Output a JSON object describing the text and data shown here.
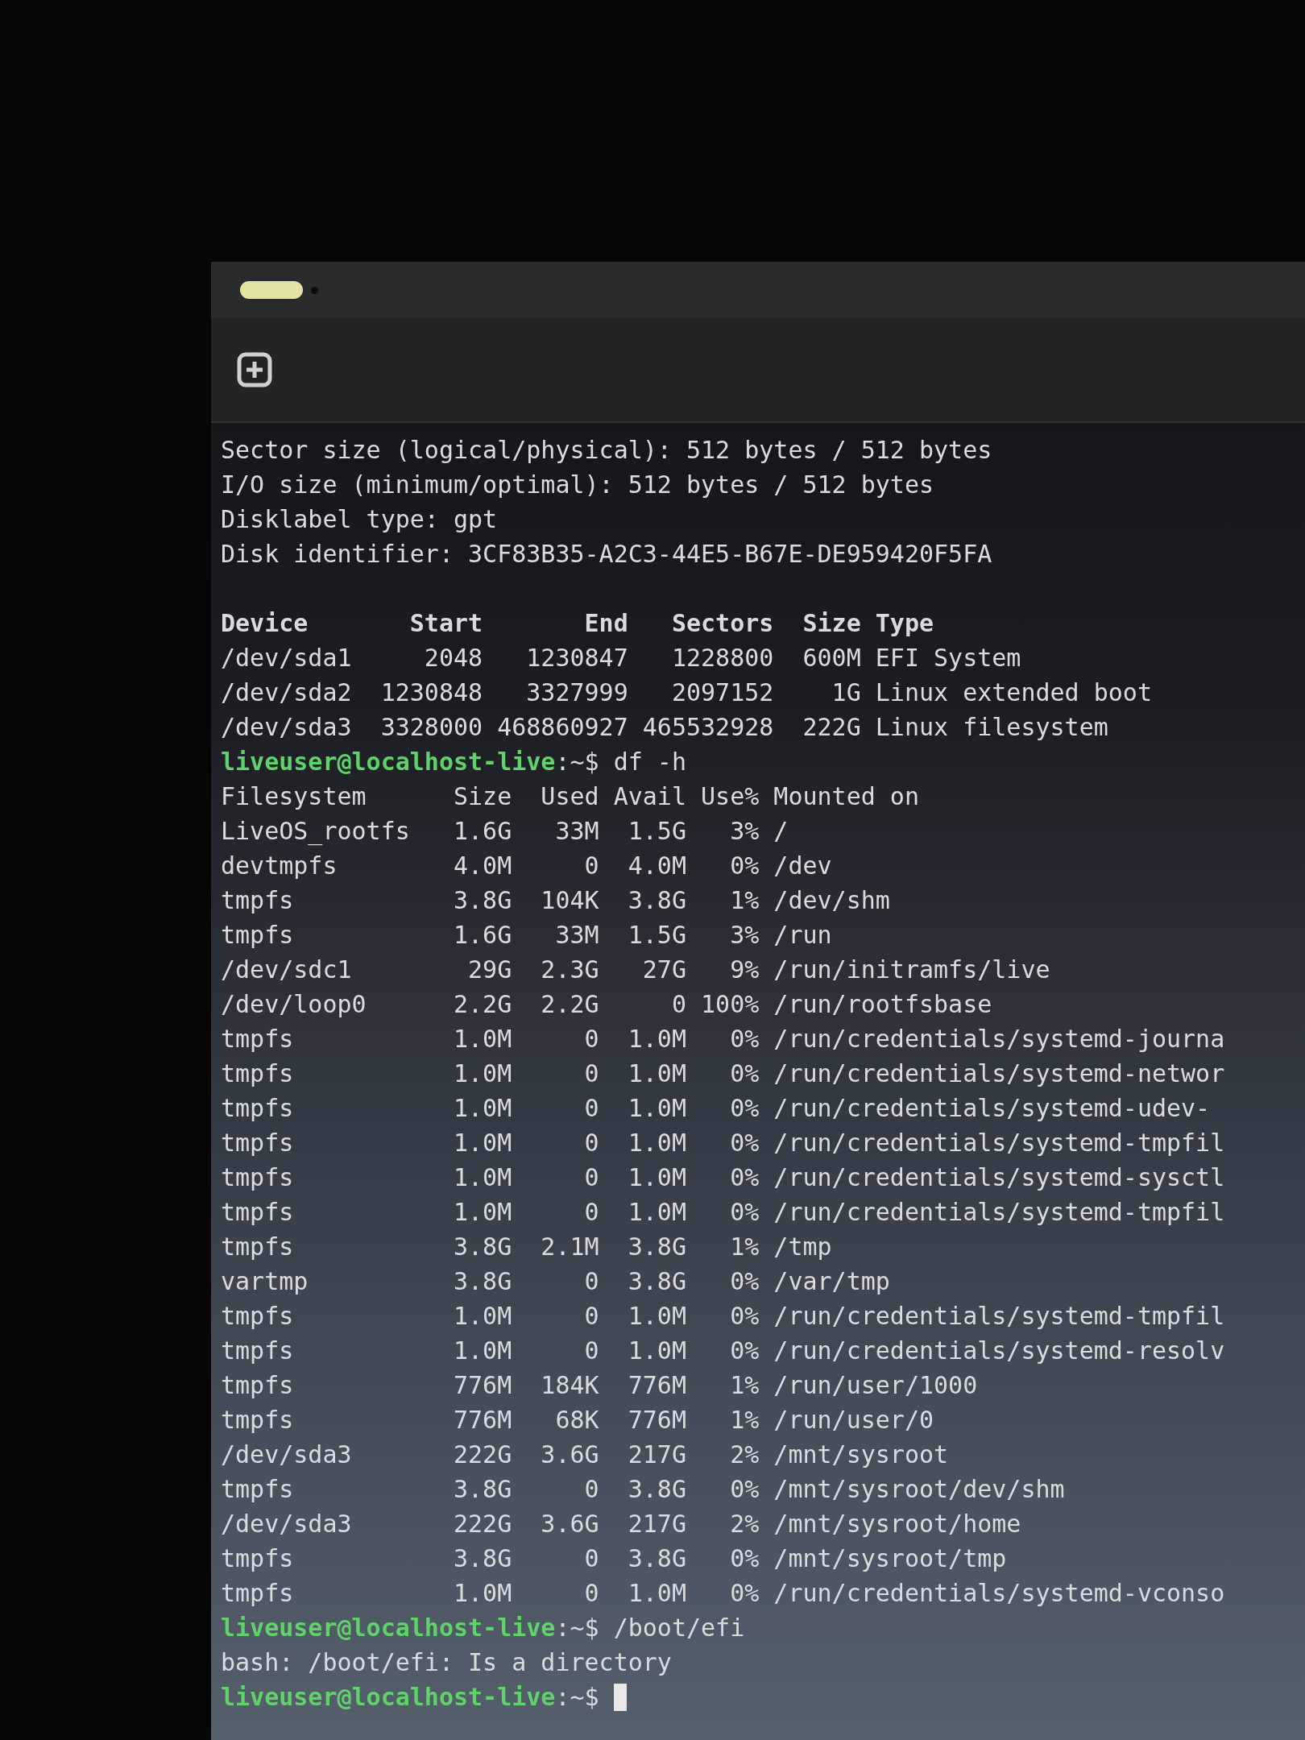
{
  "lines": [
    {
      "kind": "output",
      "text": "Sector size (logical/physical): 512 bytes / 512 bytes"
    },
    {
      "kind": "output",
      "text": "I/O size (minimum/optimal): 512 bytes / 512 bytes"
    },
    {
      "kind": "output",
      "text": "Disklabel type: gpt"
    },
    {
      "kind": "output",
      "text": "Disk identifier: 3CF83B35-A2C3-44E5-B67E-DE959420F5FA"
    },
    {
      "kind": "blank"
    },
    {
      "kind": "header",
      "text": "Device       Start       End   Sectors  Size Type"
    },
    {
      "kind": "output",
      "text": "/dev/sda1     2048   1230847   1228800  600M EFI System"
    },
    {
      "kind": "output",
      "text": "/dev/sda2  1230848   3327999   2097152    1G Linux extended boot"
    },
    {
      "kind": "output",
      "text": "/dev/sda3  3328000 468860927 465532928  222G Linux filesystem"
    },
    {
      "kind": "prompt",
      "prompt": "liveuser@localhost-live",
      "cwd": ":~$",
      "command": "df -h"
    },
    {
      "kind": "output",
      "text": "Filesystem      Size  Used Avail Use% Mounted on"
    },
    {
      "kind": "output",
      "text": "LiveOS_rootfs   1.6G   33M  1.5G   3% /"
    },
    {
      "kind": "output",
      "text": "devtmpfs        4.0M     0  4.0M   0% /dev"
    },
    {
      "kind": "output",
      "text": "tmpfs           3.8G  104K  3.8G   1% /dev/shm"
    },
    {
      "kind": "output",
      "text": "tmpfs           1.6G   33M  1.5G   3% /run"
    },
    {
      "kind": "output",
      "text": "/dev/sdc1        29G  2.3G   27G   9% /run/initramfs/live"
    },
    {
      "kind": "output",
      "text": "/dev/loop0      2.2G  2.2G     0 100% /run/rootfsbase"
    },
    {
      "kind": "output",
      "text": "tmpfs           1.0M     0  1.0M   0% /run/credentials/systemd-journa"
    },
    {
      "kind": "output",
      "text": "tmpfs           1.0M     0  1.0M   0% /run/credentials/systemd-networ"
    },
    {
      "kind": "output",
      "text": "tmpfs           1.0M     0  1.0M   0% /run/credentials/systemd-udev-"
    },
    {
      "kind": "output",
      "text": "tmpfs           1.0M     0  1.0M   0% /run/credentials/systemd-tmpfil"
    },
    {
      "kind": "output",
      "text": "tmpfs           1.0M     0  1.0M   0% /run/credentials/systemd-sysctl"
    },
    {
      "kind": "output",
      "text": "tmpfs           1.0M     0  1.0M   0% /run/credentials/systemd-tmpfil"
    },
    {
      "kind": "output",
      "text": "tmpfs           3.8G  2.1M  3.8G   1% /tmp"
    },
    {
      "kind": "output",
      "text": "vartmp          3.8G     0  3.8G   0% /var/tmp"
    },
    {
      "kind": "output",
      "text": "tmpfs           1.0M     0  1.0M   0% /run/credentials/systemd-tmpfil"
    },
    {
      "kind": "output",
      "text": "tmpfs           1.0M     0  1.0M   0% /run/credentials/systemd-resolv"
    },
    {
      "kind": "output",
      "text": "tmpfs           776M  184K  776M   1% /run/user/1000"
    },
    {
      "kind": "output",
      "text": "tmpfs           776M   68K  776M   1% /run/user/0"
    },
    {
      "kind": "output",
      "text": "/dev/sda3       222G  3.6G  217G   2% /mnt/sysroot"
    },
    {
      "kind": "output",
      "text": "tmpfs           3.8G     0  3.8G   0% /mnt/sysroot/dev/shm"
    },
    {
      "kind": "output",
      "text": "/dev/sda3       222G  3.6G  217G   2% /mnt/sysroot/home"
    },
    {
      "kind": "output",
      "text": "tmpfs           3.8G     0  3.8G   0% /mnt/sysroot/tmp"
    },
    {
      "kind": "output",
      "text": "tmpfs           1.0M     0  1.0M   0% /run/credentials/systemd-vconso"
    },
    {
      "kind": "prompt",
      "prompt": "liveuser@localhost-live",
      "cwd": ":~$",
      "command": "/boot/efi"
    },
    {
      "kind": "output",
      "text": "bash: /boot/efi: Is a directory"
    },
    {
      "kind": "prompt",
      "prompt": "liveuser@localhost-live",
      "cwd": ":~$",
      "cursor": true
    }
  ]
}
